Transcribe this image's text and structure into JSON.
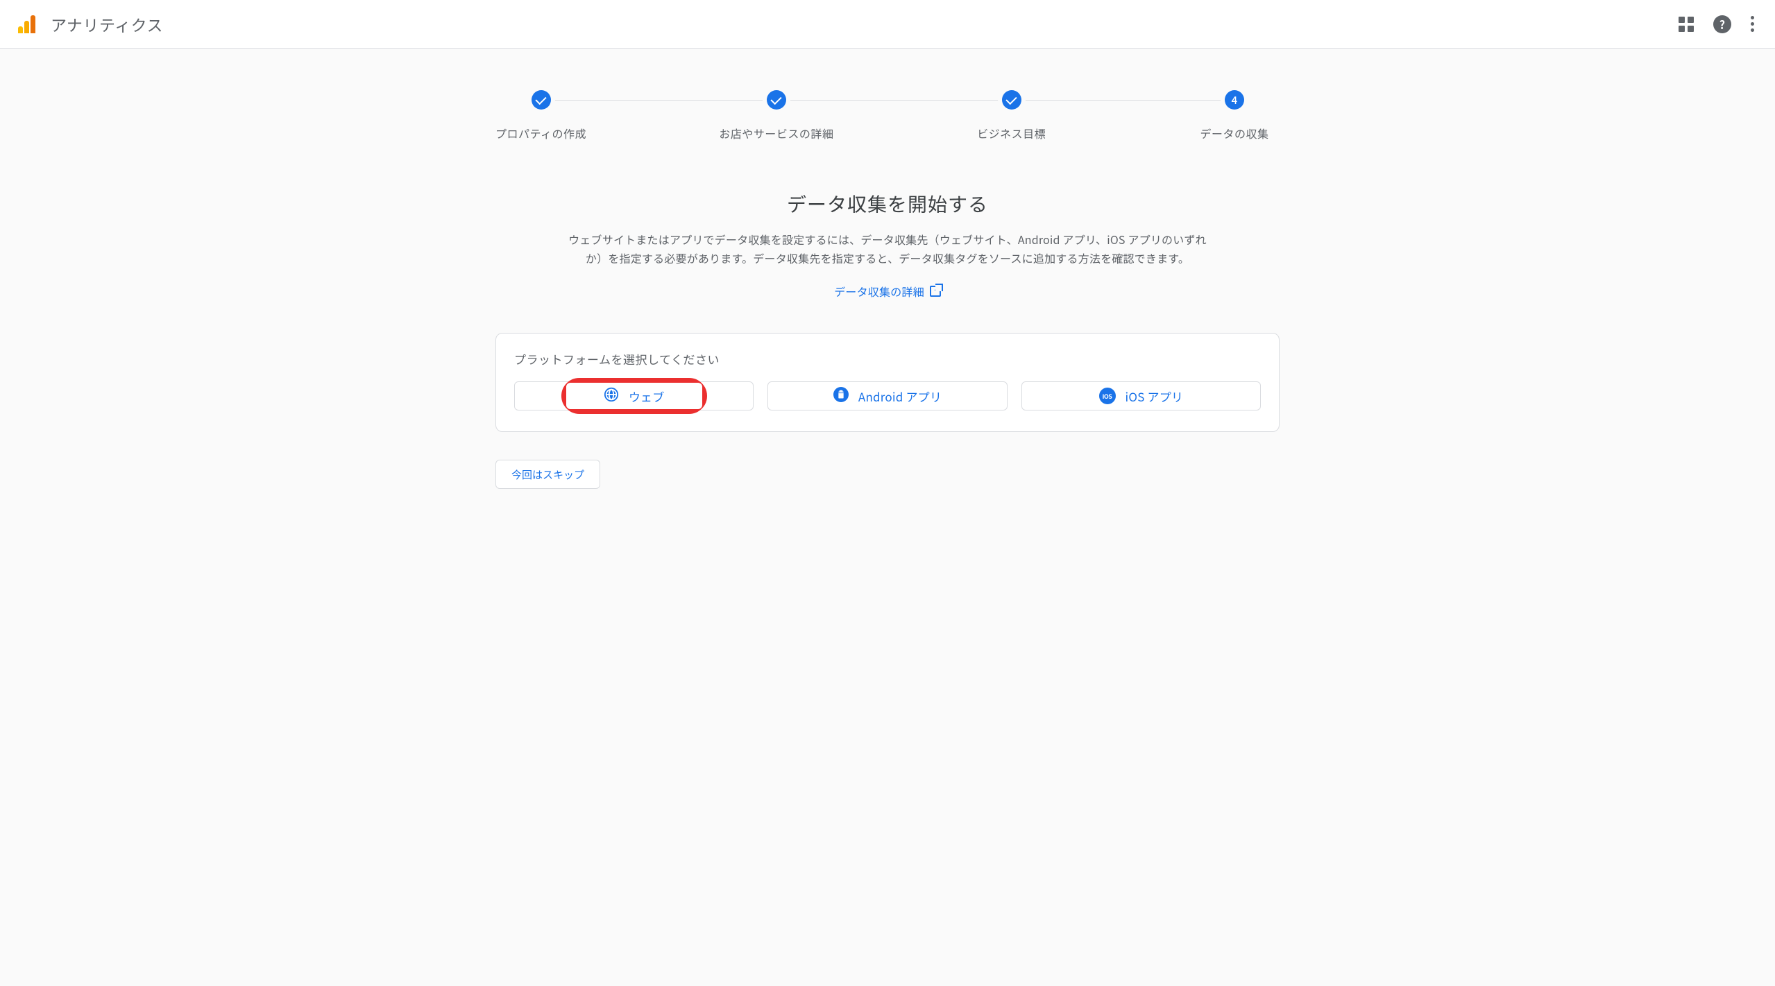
{
  "header": {
    "app_title": "アナリティクス"
  },
  "stepper": {
    "steps": [
      {
        "label": "プロパティの作成",
        "state": "done"
      },
      {
        "label": "お店やサービスの詳細",
        "state": "done"
      },
      {
        "label": "ビジネス目標",
        "state": "done"
      },
      {
        "label": "データの収集",
        "state": "current",
        "number": "4"
      }
    ]
  },
  "main": {
    "title": "データ収集を開始する",
    "description": "ウェブサイトまたはアプリでデータ収集を設定するには、データ収集先（ウェブサイト、Android アプリ、iOS アプリのいずれか）を指定する必要があります。データ収集先を指定すると、データ収集タグをソースに追加する方法を確認できます。",
    "detail_link": "データ収集の詳細"
  },
  "platform": {
    "prompt": "プラットフォームを選択してください",
    "options": {
      "web": "ウェブ",
      "android": "Android アプリ",
      "ios": "iOS アプリ"
    },
    "ios_badge": "iOS"
  },
  "actions": {
    "skip": "今回はスキップ"
  }
}
